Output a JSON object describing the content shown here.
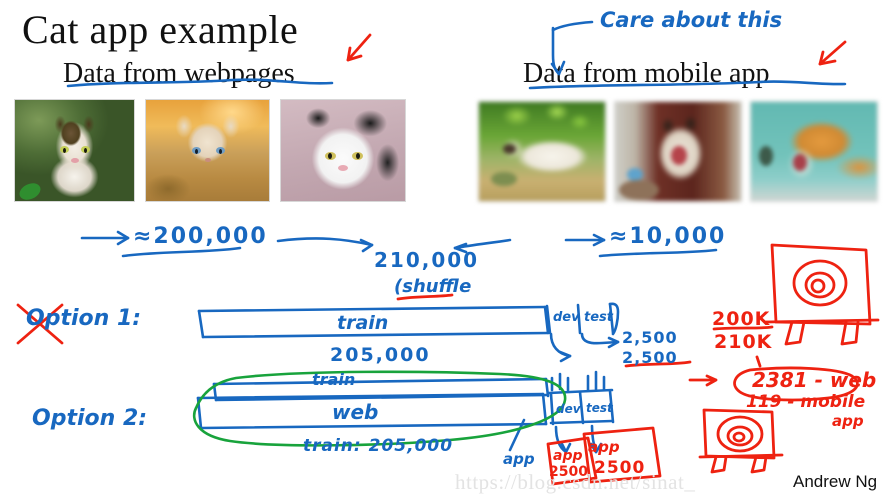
{
  "slide": {
    "title": "Cat app example",
    "author_credit": "Andrew Ng",
    "watermark": "https://blog.csdn.net/sinat_"
  },
  "colors": {
    "ink_blue": "#1868c0",
    "ink_red": "#ee2211",
    "ink_green": "#18a33c",
    "text_black": "#111111",
    "watermark_gray": "#e3e3e3"
  },
  "sections": {
    "left_header": "Data from webpages",
    "right_header": "Data from mobile app"
  },
  "annotations": {
    "care_about_this": "Care about this",
    "web_count": "≈200,000",
    "total_count": "210,000",
    "shuffle_note": "(shuffle",
    "mobile_count": "≈10,000"
  },
  "option1": {
    "label": "Option 1:",
    "crossed_out": true,
    "bar_segments": [
      {
        "name": "train",
        "label": "train",
        "count": "205,000"
      },
      {
        "name": "dev",
        "label": "dev",
        "count": "2,500"
      },
      {
        "name": "test",
        "label": "test",
        "count": "2,500"
      }
    ],
    "train_count": "205,000",
    "dev_count": "2,500",
    "test_count": "2,500"
  },
  "option2": {
    "label": "Option 2:",
    "train_label": "train",
    "web_label": "web",
    "train_count": "train: 205,000",
    "app_label": "app",
    "dev_label": "dev",
    "test_label": "test",
    "dev_box": {
      "label": "app",
      "count": "2500"
    },
    "test_box": {
      "label": "app",
      "count": "2500"
    }
  },
  "red_math": {
    "ratio_top": "200K",
    "ratio_bottom": "210K",
    "web_result": "2381 - web",
    "mobile_result": "119 - mobile",
    "mobile_result_cont": "app"
  },
  "photos": {
    "webpages": [
      {
        "name": "tabby-cat-in-garden",
        "quality": "sharp"
      },
      {
        "name": "cream-kitten-in-hay",
        "quality": "sharp"
      },
      {
        "name": "black-white-cat-portrait",
        "quality": "sharp"
      }
    ],
    "mobile": [
      {
        "name": "white-cat-lying-outdoors",
        "quality": "blurry"
      },
      {
        "name": "siamese-cat-yawning",
        "quality": "blurry"
      },
      {
        "name": "ginger-cat-grooming",
        "quality": "blurry"
      }
    ]
  },
  "icons": {
    "red_arrow_left": "arrow-down-left-icon",
    "red_arrow_right": "arrow-down-left-icon",
    "blue_arrow_down": "arrow-down-icon",
    "sketch_target_top": "target-easel-sketch-icon",
    "sketch_target_bottom": "target-easel-sketch-icon"
  }
}
